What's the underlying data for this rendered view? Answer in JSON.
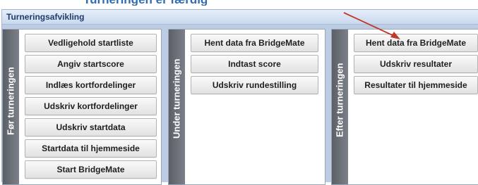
{
  "page_title": "Turneringen er færdig",
  "panel_title": "Turneringsafvikling",
  "groups": [
    {
      "label": "Før turneringen",
      "buttons": [
        "Vedligehold startliste",
        "Angiv startscore",
        "Indlæs kortfordelinger",
        "Udskriv kortfordelinger",
        "Udskriv startdata",
        "Startdata til hjemmeside",
        "Start BridgeMate"
      ]
    },
    {
      "label": "Under turneringen",
      "buttons": [
        "Hent data fra BridgeMate",
        "Indtast score",
        "Udskriv rundestilling"
      ]
    },
    {
      "label": "Efter turneringen",
      "buttons": [
        "Hent data fra BridgeMate",
        "Udskriv resultater",
        "Resultater til hjemmeside"
      ]
    }
  ],
  "colors": {
    "panel_bg": "#bccde3",
    "label_bar": "#6b6f76",
    "arrow": "#c0392b"
  }
}
